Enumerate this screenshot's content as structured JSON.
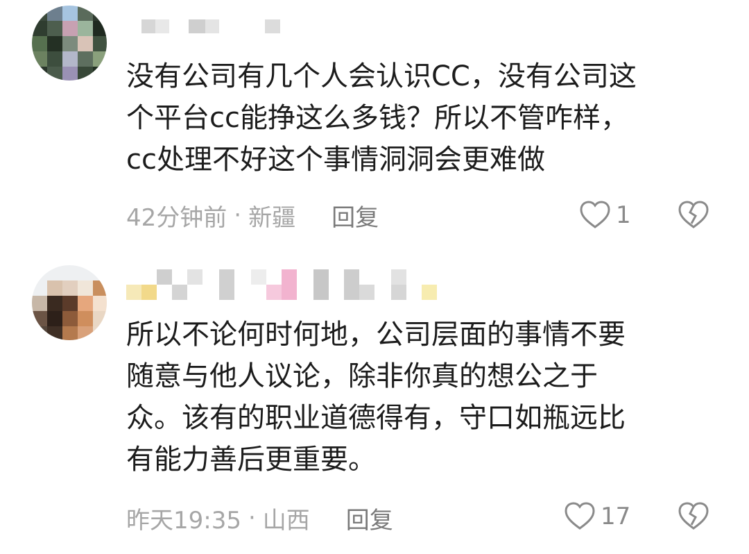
{
  "comments": [
    {
      "body": "没有公司有几个人会认识CC，没有公司这\n个平台cc能挣这么多钱？所以不管咋样，\ncc处理不好这个事情洞洞会更难做",
      "time": "42分钟前",
      "separator": "·",
      "location": "新疆",
      "reply_label": "回复",
      "like_count": "1"
    },
    {
      "body": "所以不论何时何地，公司层面的事情不要\n随意与他人议论，除非你真的想公之于\n众。该有的职业道德得有，守口如瓶远比\n有能力善后更重要。",
      "time": "昨天19:35",
      "separator": "·",
      "location": "山西",
      "reply_label": "回复",
      "like_count": "17"
    }
  ],
  "icons": {
    "like": "heart-outline-icon",
    "dislike": "broken-heart-icon"
  },
  "colors": {
    "text": "#1c1c1c",
    "meta": "#a6a6a6",
    "icon": "#8a8a8a"
  }
}
